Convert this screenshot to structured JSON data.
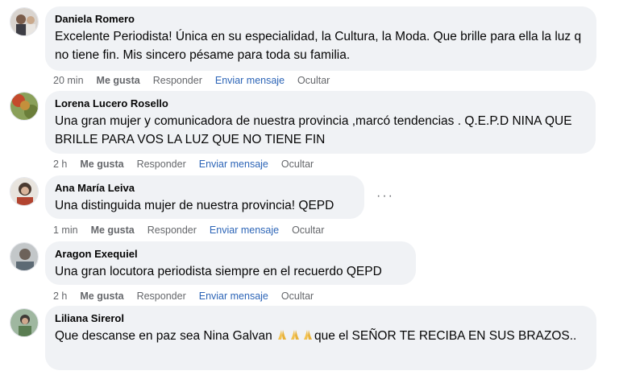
{
  "comments": [
    {
      "author": "Daniela Romero",
      "text": "Excelente Periodista! Única en su especialidad, la Cultura, la Moda. Que brille para ella la luz q no tiene fin. Mis sincero pésame para toda su familia.",
      "time": "20 min",
      "like": "Me gusta",
      "reply": "Responder",
      "message": "Enviar mensaje",
      "hide": "Ocultar"
    },
    {
      "author": "Lorena Lucero Rosello",
      "text": "Una gran mujer y comunicadora de nuestra provincia ,marcó tendencias . Q.E.P.D NINA QUE BRILLE PARA VOS LA LUZ QUE NO TIENE FIN",
      "time": "2 h",
      "like": "Me gusta",
      "reply": "Responder",
      "message": "Enviar mensaje",
      "hide": "Ocultar"
    },
    {
      "author": "Ana María Leiva",
      "text": "Una distinguida mujer de nuestra provincia! QEPD",
      "time": "1 min",
      "like": "Me gusta",
      "reply": "Responder",
      "message": "Enviar mensaje",
      "hide": "Ocultar",
      "more": "···"
    },
    {
      "author": "Aragon Exequiel",
      "text": "Una gran locutora periodista siempre en el recuerdo QEPD",
      "time": "2 h",
      "like": "Me gusta",
      "reply": "Responder",
      "message": "Enviar mensaje",
      "hide": "Ocultar"
    },
    {
      "author": "Liliana Sirerol",
      "text_before": "Que descanse en paz sea Nina Galvan",
      "emoji": "folded-hands-emoji x3",
      "text_after": "que el SEÑOR TE RECIBA EN SUS BRAZOS.."
    }
  ],
  "colors": {
    "bubble": "#f0f2f5",
    "meta": "#65676b",
    "link": "#2d65b7",
    "text": "#050505"
  }
}
